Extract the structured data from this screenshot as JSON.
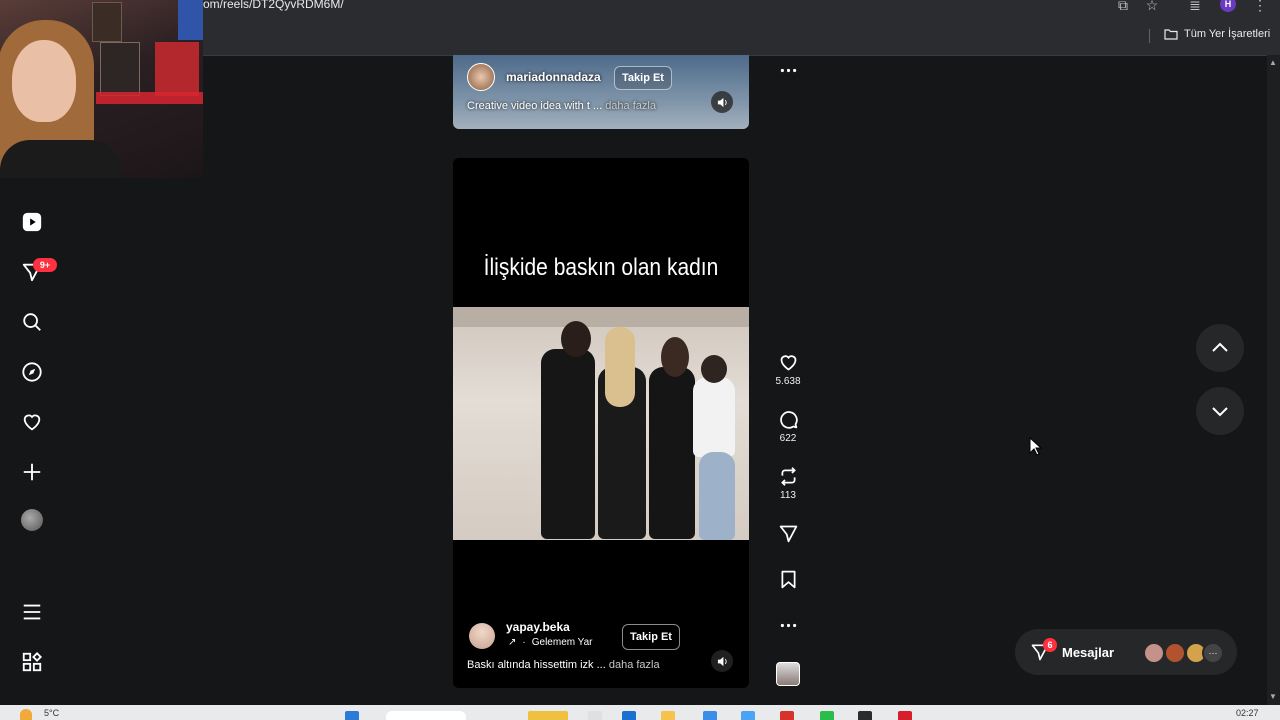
{
  "browser": {
    "url": "om/reels/DT2QyvRDM6M/",
    "profile_initial": "H",
    "bookmarks_folder": "Tüm Yer İşaretleri"
  },
  "sidebar": {
    "notification_badge": "9+",
    "icons": [
      "reels-icon",
      "messages-icon",
      "search-icon",
      "explore-icon",
      "heart-icon",
      "create-icon",
      "profile-avatar",
      "menu-icon",
      "more-apps-icon"
    ]
  },
  "reel_previous": {
    "username": "mariadonnadaza",
    "follow_label": "Takip Et",
    "caption": "Creative video idea with t ...",
    "more_label": "daha fazla"
  },
  "reel_current": {
    "overlay_text": "İlişkide baskın olan kadın",
    "username": "yapay.beka",
    "audio": "Gelemem Yar",
    "follow_label": "Takip Et",
    "caption": "Baskı altında hissettim izk ...",
    "more_label": "daha fazla",
    "likes": "5.638",
    "comments": "622",
    "reposts": "113"
  },
  "messages": {
    "label": "Mesajlar",
    "badge": "6"
  },
  "taskbar": {
    "temperature": "5°C",
    "time": "02:27"
  },
  "colors": {
    "background": "#151617",
    "badge_red": "#ff3040",
    "reel_bg": "#000000",
    "pill_bg": "#262728"
  }
}
